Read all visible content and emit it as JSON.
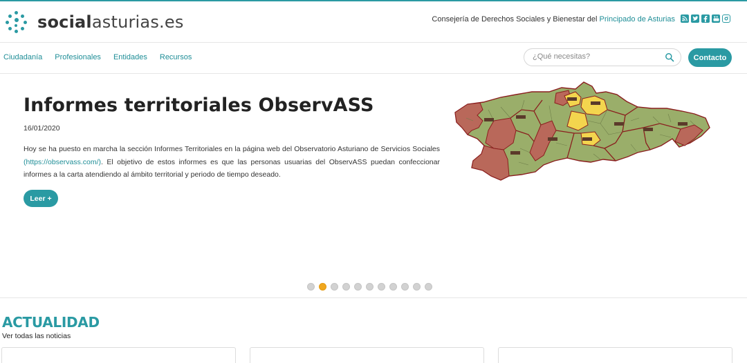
{
  "brand": {
    "logo_bold": "social",
    "logo_light": "asturias.es",
    "accent_color": "#2a9aa3"
  },
  "header": {
    "consejeria_text": "Consejería de Derechos Sociales y Bienestar del ",
    "consejeria_link": "Principado de Asturias",
    "social_icons": [
      "rss-icon",
      "twitter-icon",
      "facebook-icon",
      "youtube-icon",
      "instagram-icon"
    ]
  },
  "nav": {
    "items": [
      "Ciudadanía",
      "Profesionales",
      "Entidades",
      "Recursos"
    ],
    "search_placeholder": "¿Qué necesitas?",
    "contact_label": "Contacto"
  },
  "slide": {
    "title": "Informes territoriales ObservASS",
    "date": "16/01/2020",
    "text_before_link": "Hoy se ha puesto en marcha la sección Informes Territoriales en la página web del Observatorio Asturiano de Servicios Sociales ",
    "link": "(https://observass.com/)",
    "text_after_link": ". El objetivo de estos informes es que las personas usuarias del ObservASS puedan confeccionar informes a la carta atendiendo al ámbito territorial y periodo de tiempo deseado.",
    "read_more_label": "Leer +",
    "map_colors": {
      "green": "#9aae6a",
      "red": "#b9685a",
      "yellow": "#f3d54e",
      "border": "#8a1e1e"
    }
  },
  "slider": {
    "total_slides": 11,
    "active_slide": 2
  },
  "news": {
    "title": "ACTUALIDAD",
    "see_all": "Ver todas las noticias"
  }
}
